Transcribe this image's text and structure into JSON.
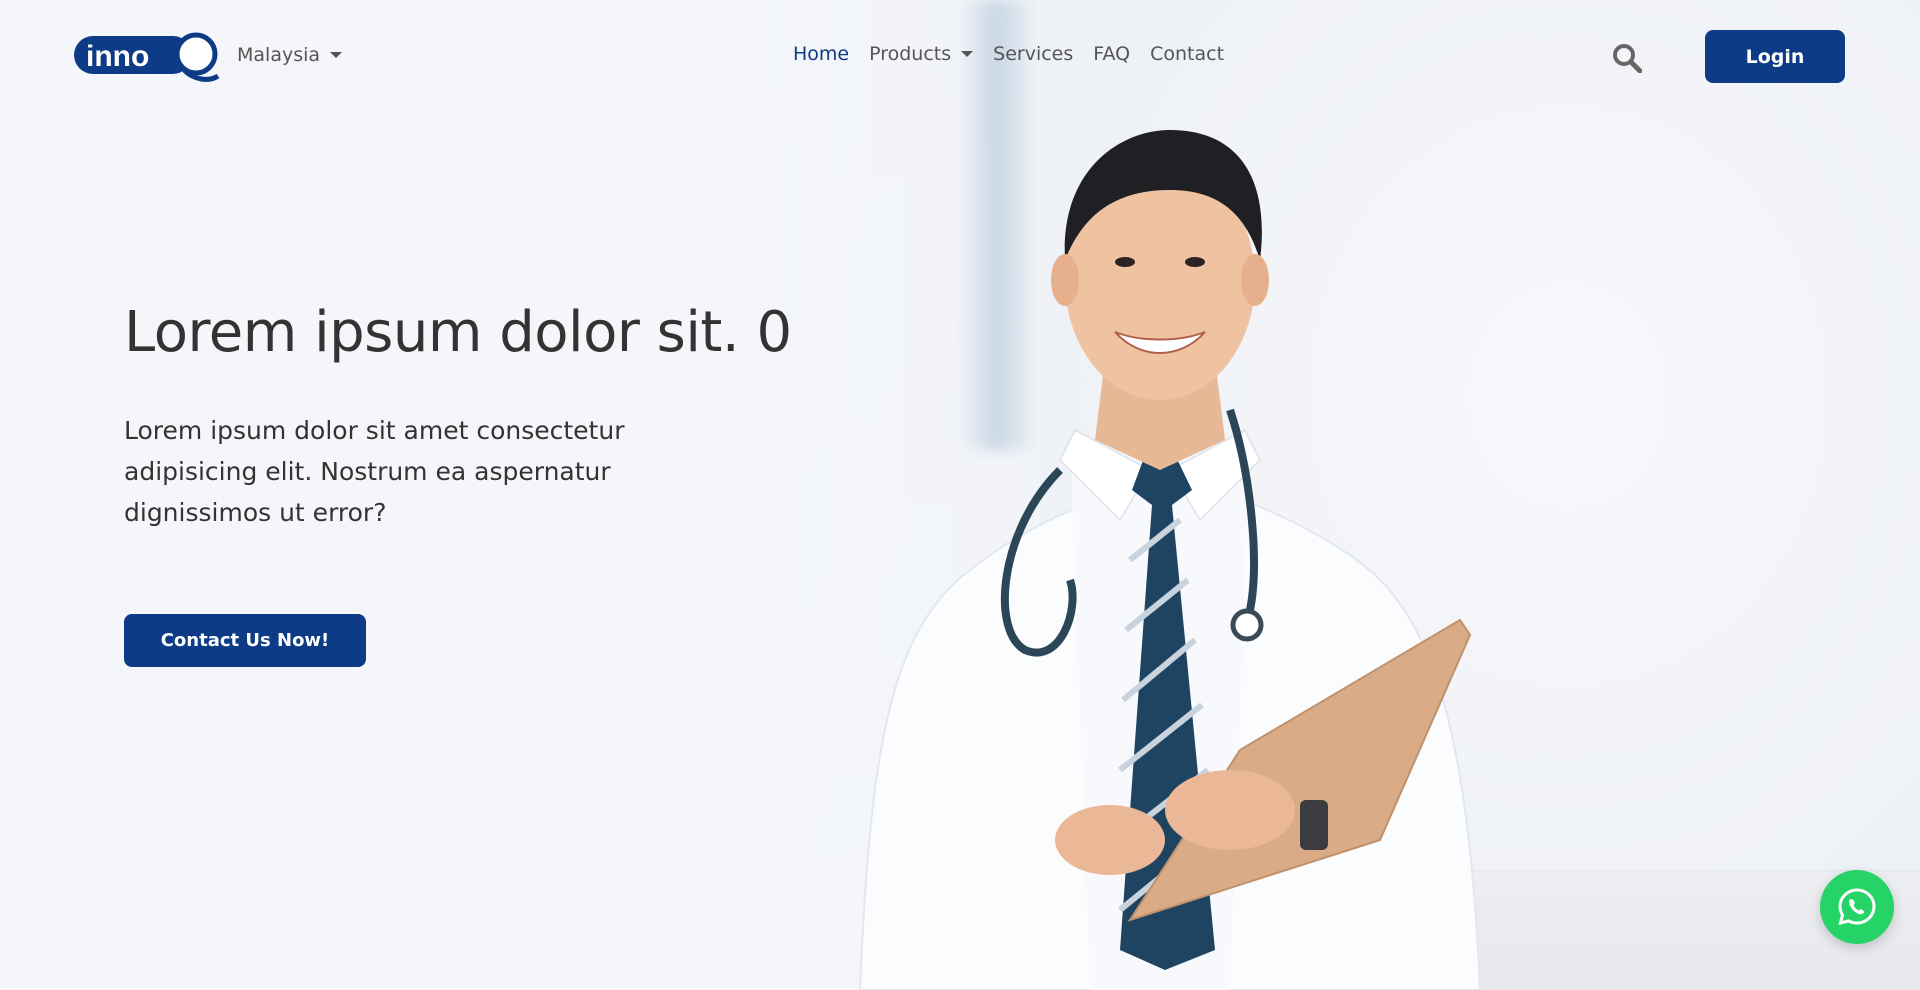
{
  "brand": {
    "logo_text": "inno",
    "logo_color": "#0d3b85"
  },
  "nav": {
    "country": "Malaysia",
    "links": [
      {
        "label": "Home",
        "active": true
      },
      {
        "label": "Products",
        "dropdown": true
      },
      {
        "label": "Services"
      },
      {
        "label": "FAQ"
      },
      {
        "label": "Contact"
      }
    ],
    "search_icon": "search-icon",
    "login_label": "Login"
  },
  "hero": {
    "title": "Lorem ipsum dolor sit. 0",
    "text": "Lorem ipsum dolor sit amet consectetur adipisicing elit. Nostrum ea aspernatur dignissimos ut error?",
    "cta_label": "Contact Us Now!"
  },
  "floating": {
    "whatsapp_icon": "whatsapp-icon",
    "whatsapp_color": "#25d366"
  },
  "colors": {
    "primary": "#0d3b85",
    "text": "#333333",
    "nav_text": "#555555"
  }
}
